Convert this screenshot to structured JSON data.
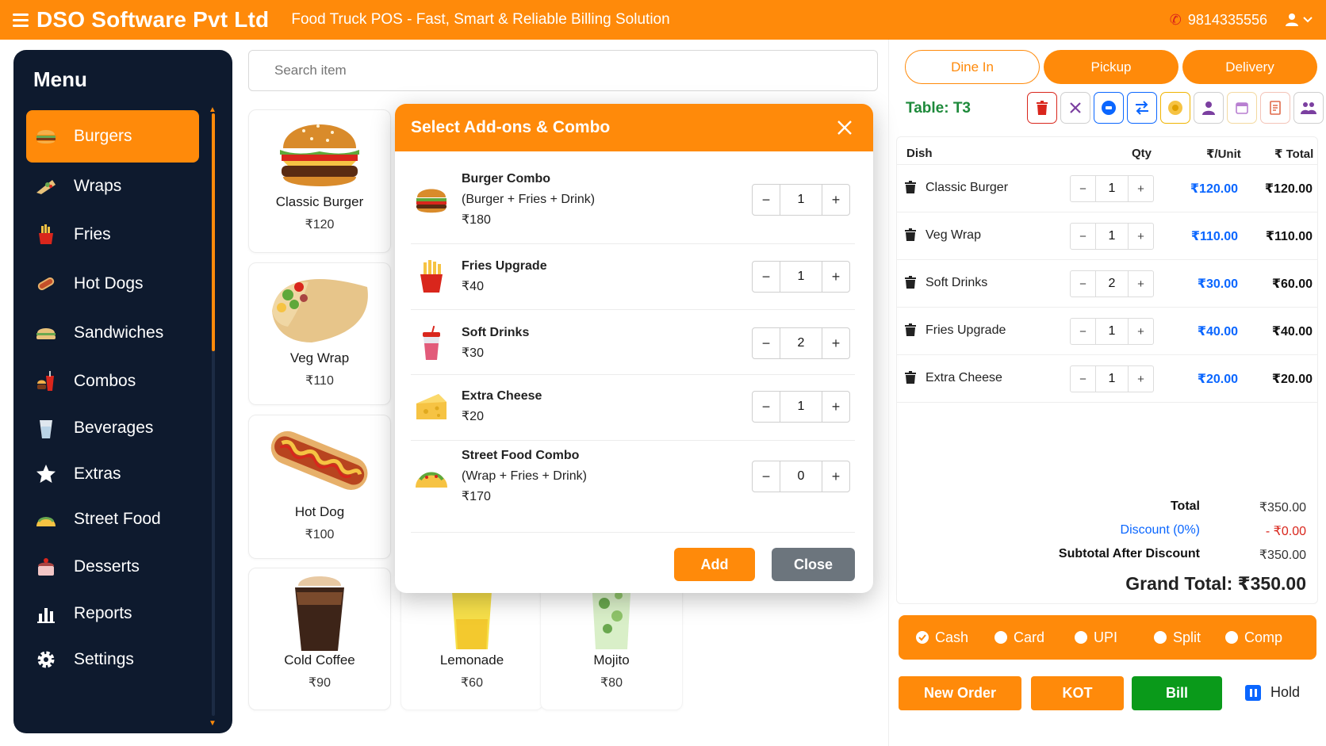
{
  "header": {
    "brand": "DSO Software Pvt Ltd",
    "tagline": "Food Truck POS - Fast, Smart & Reliable Billing Solution",
    "phone": "9814335556",
    "accent_color": "#ff8a0a"
  },
  "sidebar": {
    "title": "Menu",
    "items": [
      {
        "label": "Burgers",
        "icon": "burger-icon",
        "active": true
      },
      {
        "label": "Wraps",
        "icon": "wrap-icon"
      },
      {
        "label": "Fries",
        "icon": "fries-icon"
      },
      {
        "label": "Hot Dogs",
        "icon": "hotdog-icon"
      },
      {
        "label": "Sandwiches",
        "icon": "sandwich-icon"
      },
      {
        "label": "Combos",
        "icon": "combo-icon"
      },
      {
        "label": "Beverages",
        "icon": "beverage-icon"
      },
      {
        "label": "Extras",
        "icon": "star-icon"
      },
      {
        "label": "Street Food",
        "icon": "taco-icon"
      },
      {
        "label": "Desserts",
        "icon": "cake-icon"
      },
      {
        "label": "Reports",
        "icon": "chart-icon"
      },
      {
        "label": "Settings",
        "icon": "gear-icon"
      }
    ]
  },
  "search": {
    "placeholder": "Search item"
  },
  "products": [
    {
      "name": "Classic Burger",
      "price": "₹120"
    },
    {
      "name": "Veg Wrap",
      "price": "₹110"
    },
    {
      "name": "Hot Dog",
      "price": "₹100"
    },
    {
      "name": "Cold Coffee",
      "price": "₹90"
    },
    {
      "name": "Lemonade",
      "price": "₹60"
    },
    {
      "name": "Mojito",
      "price": "₹80"
    }
  ],
  "modal": {
    "title": "Select Add-ons & Combo",
    "addons": [
      {
        "name": "Burger Combo",
        "desc": "(Burger + Fries + Drink)",
        "price": "₹180",
        "qty": "1"
      },
      {
        "name": "Fries Upgrade",
        "desc": "",
        "price": "₹40",
        "qty": "1"
      },
      {
        "name": "Soft Drinks",
        "desc": "",
        "price": "₹30",
        "qty": "2"
      },
      {
        "name": "Extra Cheese",
        "desc": "",
        "price": "₹20",
        "qty": "1"
      },
      {
        "name": "Street Food Combo",
        "desc": "(Wrap + Fries + Drink)",
        "price": "₹170",
        "qty": "0"
      }
    ],
    "add_label": "Add",
    "close_label": "Close",
    "minus": "−",
    "plus": "+"
  },
  "order": {
    "tabs": {
      "dine_in": "Dine In",
      "pickup": "Pickup",
      "delivery": "Delivery"
    },
    "table": "Table: T3",
    "columns": {
      "dish": "Dish",
      "qty": "Qty",
      "unit": "₹/Unit",
      "total": "₹ Total"
    },
    "items": [
      {
        "dish": "Classic Burger",
        "qty": "1",
        "unit": "₹120.00",
        "total": "₹120.00"
      },
      {
        "dish": "Veg Wrap",
        "qty": "1",
        "unit": "₹110.00",
        "total": "₹110.00"
      },
      {
        "dish": "Soft Drinks",
        "qty": "2",
        "unit": "₹30.00",
        "total": "₹60.00"
      },
      {
        "dish": "Fries Upgrade",
        "qty": "1",
        "unit": "₹40.00",
        "total": "₹40.00"
      },
      {
        "dish": "Extra Cheese",
        "qty": "1",
        "unit": "₹20.00",
        "total": "₹20.00"
      }
    ],
    "summary": {
      "total_label": "Total",
      "total_value": "₹350.00",
      "discount_label": "Discount (0%)",
      "discount_value": "- ₹0.00",
      "subtotal_label": "Subtotal After Discount",
      "subtotal_value": "₹350.00",
      "grand_total": "Grand Total: ₹350.00"
    }
  },
  "payment": {
    "options": [
      "Cash",
      "Card",
      "UPI",
      "Split",
      "Comp"
    ],
    "selected": "Cash"
  },
  "actions": {
    "new_order": "New Order",
    "kot": "KOT",
    "bill": "Bill",
    "hold": "Hold"
  }
}
